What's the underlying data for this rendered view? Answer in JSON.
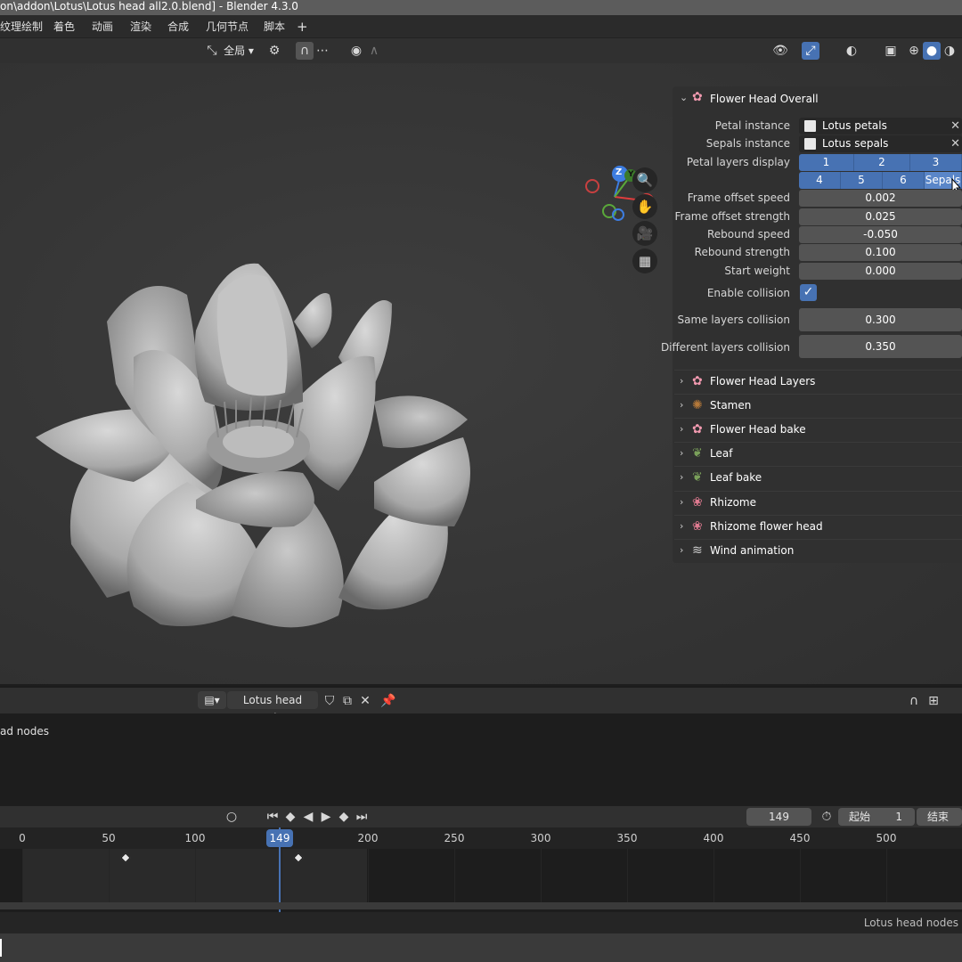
{
  "window": {
    "title": "on\\addon\\Lotus\\Lotus head all2.0.blend] - Blender 4.3.0"
  },
  "menubar": {
    "items": [
      "纹理绘制",
      "着色",
      "动画",
      "渲染",
      "合成",
      "几何节点",
      "脚本",
      "+"
    ]
  },
  "viewport_header": {
    "transform_orientation": "全局",
    "icons": [
      "pivot-icon",
      "snap-icon",
      "proportional-icon",
      "overlay-icon",
      "gizmo-icon",
      "shading-wireframe-icon",
      "shading-solid-icon",
      "shading-material-icon"
    ]
  },
  "npanel": {
    "main_panel": {
      "title": "Flower Head Overall",
      "petal_instance": {
        "label": "Petal instance",
        "value": "Lotus petals"
      },
      "sepals_instance": {
        "label": "Sepals instance",
        "value": "Lotus sepals"
      },
      "petal_layers": {
        "label": "Petal layers display",
        "row1": [
          "1",
          "2",
          "3"
        ],
        "row2": [
          "4",
          "5",
          "6",
          "Sepals"
        ]
      },
      "frame_offset_speed": {
        "label": "Frame offset speed",
        "value": "0.002"
      },
      "frame_offset_strength": {
        "label": "Frame offset strength",
        "value": "0.025"
      },
      "rebound_speed": {
        "label": "Rebound speed",
        "value": "-0.050"
      },
      "rebound_strength": {
        "label": "Rebound strength",
        "value": "0.100"
      },
      "start_weight": {
        "label": "Start weight",
        "value": "0.000"
      },
      "enable_collision": {
        "label": "Enable collision",
        "checked": true
      },
      "same_layers_collision": {
        "label": "Same layers collision",
        "value": "0.300"
      },
      "different_layers_collision": {
        "label": "Different layers collision",
        "value": "0.350"
      }
    },
    "subpanels": [
      {
        "title": "Flower Head Layers",
        "icon": "flower-icon"
      },
      {
        "title": "Stamen",
        "icon": "stamen-icon"
      },
      {
        "title": "Flower Head bake",
        "icon": "flower-icon"
      },
      {
        "title": "Leaf",
        "icon": "leaf-icon"
      },
      {
        "title": "Leaf bake",
        "icon": "leaf-icon"
      },
      {
        "title": "Rhizome",
        "icon": "rhizome-icon"
      },
      {
        "title": "Rhizome flower head",
        "icon": "rhizome-icon"
      },
      {
        "title": "Wind animation",
        "icon": "wind-icon"
      }
    ]
  },
  "gizmo": {
    "x": "X",
    "y": "Y",
    "z": "Z"
  },
  "node_editor": {
    "node_group": "Lotus head nodes",
    "breadcrumb": "ad nodes"
  },
  "timeline": {
    "current_frame": "149",
    "start_label": "起始",
    "start_value": "1",
    "end_label": "结束",
    "ticks": [
      "0",
      "50",
      "100",
      "150",
      "200",
      "250",
      "300",
      "350",
      "400",
      "450",
      "500"
    ],
    "playhead_label": "149",
    "keyframes": [
      60,
      160
    ]
  },
  "statusbar": {
    "text": "Lotus head nodes"
  },
  "colors": {
    "accent": "#4772b3",
    "panel": "#303030",
    "field": "#545454"
  }
}
